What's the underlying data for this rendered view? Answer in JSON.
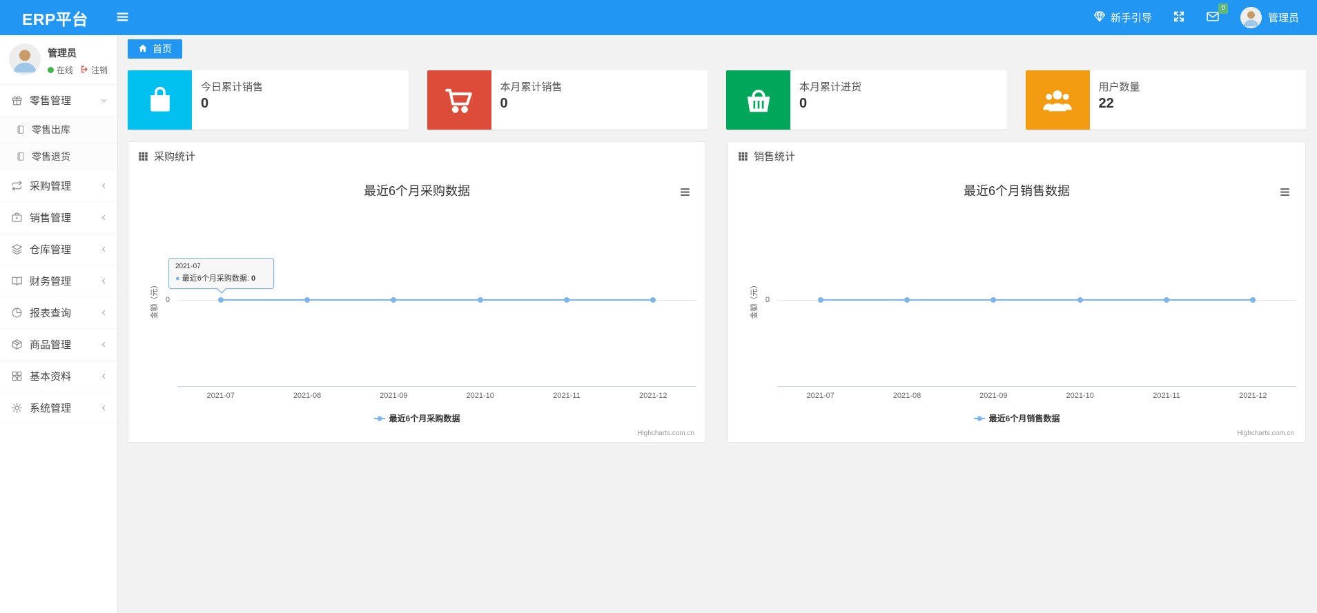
{
  "navbar": {
    "brand": "ERP平台",
    "guide_label": "新手引导",
    "message_badge": "0",
    "user_name": "管理员",
    "accent_color": "#2196f3"
  },
  "sidebar": {
    "user": {
      "name": "管理员",
      "status": "在线",
      "logout_label": "注销"
    },
    "menu": [
      {
        "label": "零售管理",
        "icon": "gift-icon",
        "expanded": true,
        "children": [
          {
            "label": "零售出库"
          },
          {
            "label": "零售退货"
          }
        ]
      },
      {
        "label": "采购管理",
        "icon": "repeat-icon",
        "expanded": false
      },
      {
        "label": "销售管理",
        "icon": "briefcase-icon",
        "expanded": false
      },
      {
        "label": "仓库管理",
        "icon": "layers-icon",
        "expanded": false
      },
      {
        "label": "财务管理",
        "icon": "open-book-icon",
        "expanded": false
      },
      {
        "label": "报表查询",
        "icon": "pie-chart-icon",
        "expanded": false
      },
      {
        "label": "商品管理",
        "icon": "package-icon",
        "expanded": false
      },
      {
        "label": "基本资料",
        "icon": "grid-icon",
        "expanded": false
      },
      {
        "label": "系统管理",
        "icon": "gear-icon",
        "expanded": false
      }
    ]
  },
  "tabs": {
    "home": "首页"
  },
  "stat_cards": [
    {
      "label": "今日累计销售",
      "value": "0",
      "color": "#00c0ef",
      "icon": "shopping-bag-icon"
    },
    {
      "label": "本月累计销售",
      "value": "0",
      "color": "#dd4b39",
      "icon": "shopping-cart-icon"
    },
    {
      "label": "本月累计进货",
      "value": "0",
      "color": "#00a65a",
      "icon": "shopping-basket-icon"
    },
    {
      "label": "用户数量",
      "value": "22",
      "color": "#f39c12",
      "icon": "users-icon"
    }
  ],
  "panels": [
    {
      "header": "采购统计"
    },
    {
      "header": "销售统计"
    }
  ],
  "chart_data": [
    {
      "type": "line",
      "title": "最近6个月采购数据",
      "categories": [
        "2021-07",
        "2021-08",
        "2021-09",
        "2021-10",
        "2021-11",
        "2021-12"
      ],
      "series": [
        {
          "name": "最近6个月采购数据",
          "values": [
            0,
            0,
            0,
            0,
            0,
            0
          ],
          "color": "#7cb5ec"
        }
      ],
      "ylabel": "金额（元）",
      "yticks": [
        "0"
      ],
      "ylim": [
        0,
        0
      ],
      "grid": true,
      "legend_position": "bottom",
      "credits": "Highcharts.com.cn",
      "tooltip": {
        "header": "2021-07",
        "series": "最近6个月采购数据",
        "value": "0"
      }
    },
    {
      "type": "line",
      "title": "最近6个月销售数据",
      "categories": [
        "2021-07",
        "2021-08",
        "2021-09",
        "2021-10",
        "2021-11",
        "2021-12"
      ],
      "series": [
        {
          "name": "最近6个月销售数据",
          "values": [
            0,
            0,
            0,
            0,
            0,
            0
          ],
          "color": "#7cb5ec"
        }
      ],
      "ylabel": "金额（元）",
      "yticks": [
        "0"
      ],
      "ylim": [
        0,
        0
      ],
      "grid": true,
      "legend_position": "bottom",
      "credits": "Highcharts.com.cn"
    }
  ]
}
